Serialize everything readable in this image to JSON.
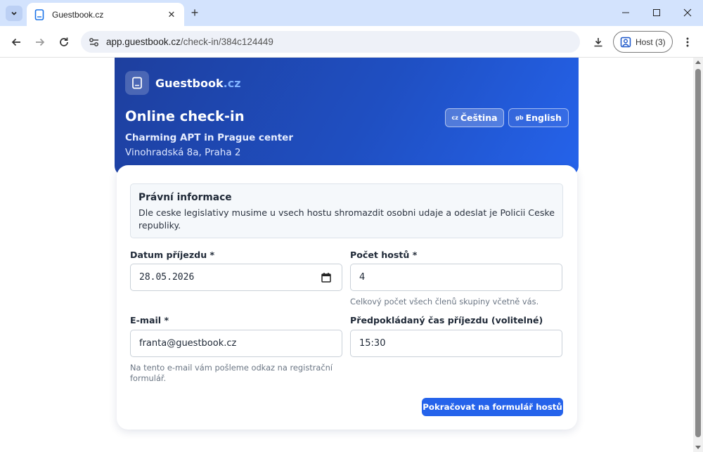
{
  "browser": {
    "tab_title": "Guestbook.cz",
    "url_host": "app.guestbook.cz",
    "url_path": "/check-in/384c124449",
    "profile_label": "Host (3)"
  },
  "header": {
    "brand_name": "Guestbook",
    "brand_tld": ".cz",
    "title": "Online check-in",
    "property_name": "Charming APT in Prague center",
    "address": "Vinohradská 8a, Praha 2",
    "languages": [
      {
        "flag": "cz",
        "label": "Čeština",
        "active": true
      },
      {
        "flag": "gb",
        "label": "English",
        "active": false
      }
    ]
  },
  "legal": {
    "title": "Právní informace",
    "text": "Dle ceske legislativy musime u vsech hostu shromazdit osobni udaje a odeslat je Policii Ceske republiky."
  },
  "form": {
    "arrival_date": {
      "label": "Datum příjezdu *",
      "value": "28.05.2026"
    },
    "guest_count": {
      "label": "Počet hostů *",
      "value": "4",
      "hint": "Celkový počet všech členů skupiny včetně vás."
    },
    "email": {
      "label": "E-mail *",
      "value": "franta@guestbook.cz",
      "hint": "Na tento e-mail vám pošleme odkaz na registrační formulář."
    },
    "arrival_time": {
      "label": "Předpokládaný čas příjezdu (volitelné)",
      "value": "15:30"
    },
    "submit_label": "Pokračovat na formulář hostů"
  },
  "colors": {
    "accent": "#2563eb",
    "hero_start": "#1e3f9e",
    "tab_strip": "#d3e3fd"
  }
}
